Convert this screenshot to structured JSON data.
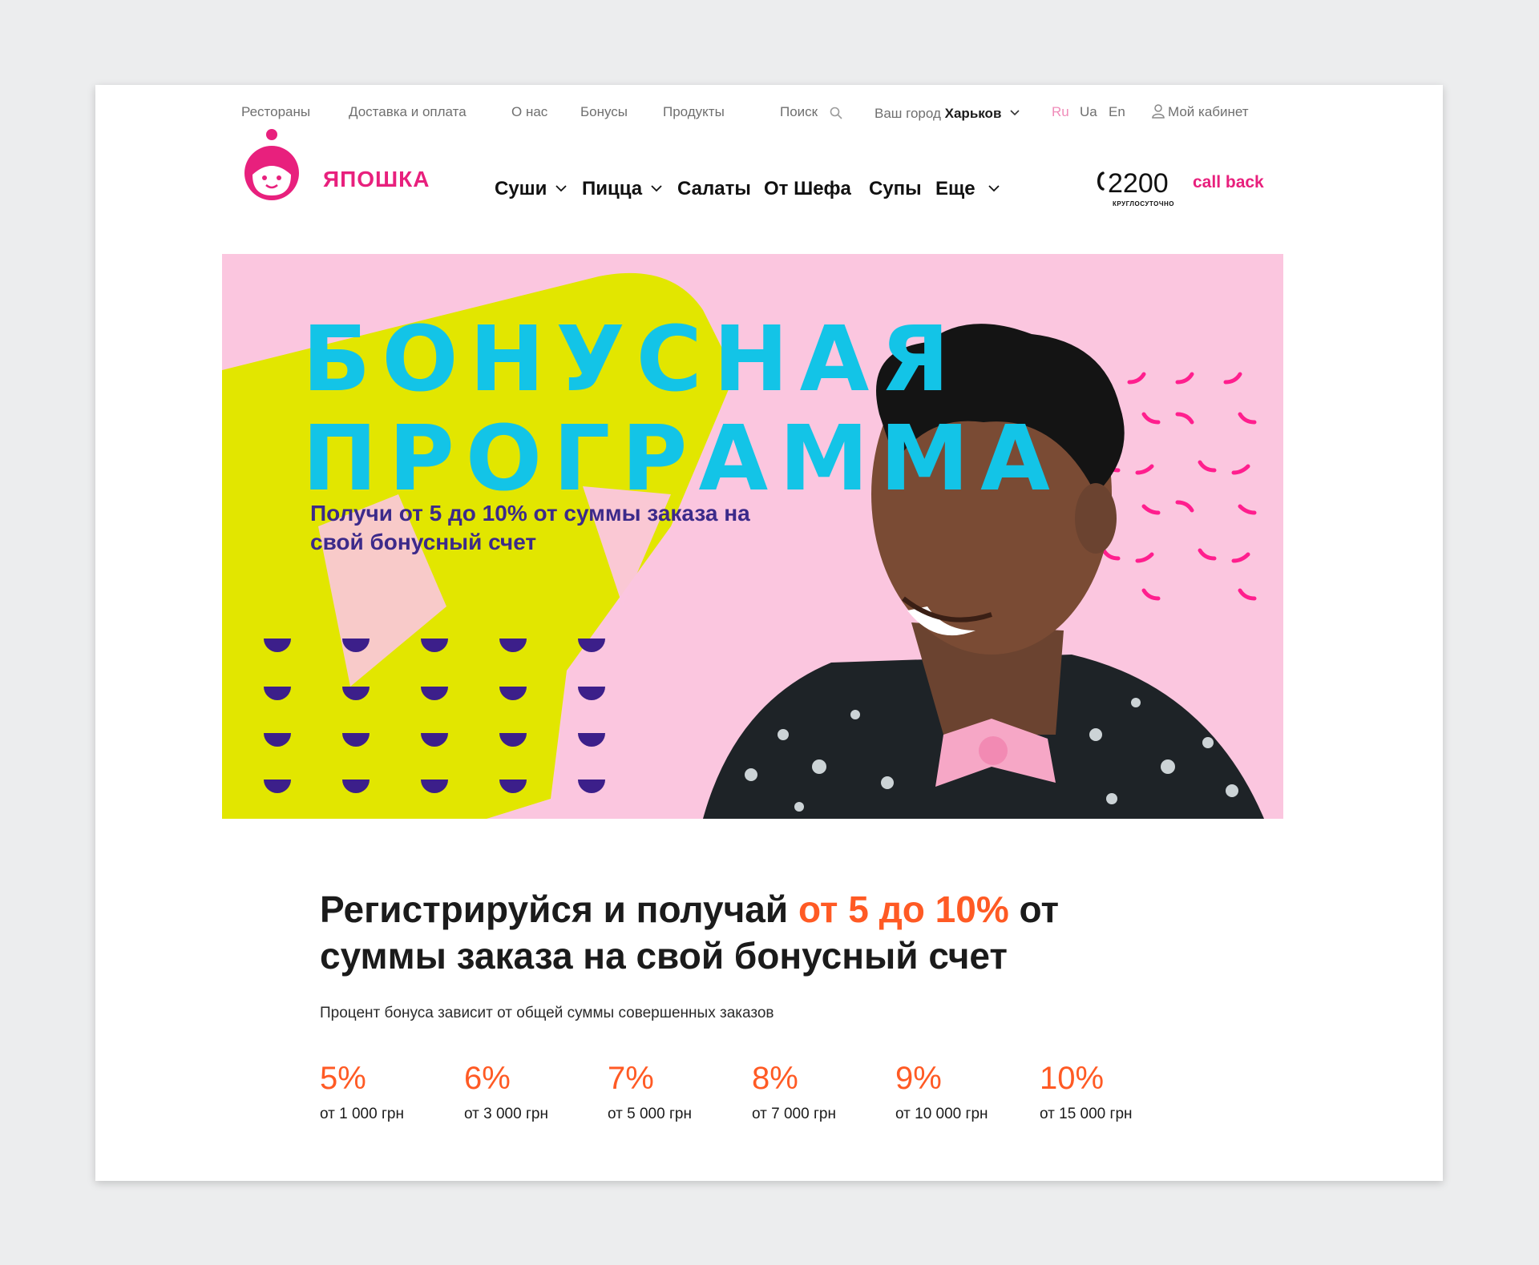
{
  "topbar": {
    "links": [
      "Рестораны",
      "Доставка и оплата",
      "О нас",
      "Бонусы",
      "Продукты"
    ],
    "search_label": "Поиск",
    "city_label": "Ваш город",
    "city_value": "Харьков",
    "languages": [
      "Ru",
      "Ua",
      "En"
    ],
    "active_language": "Ru",
    "cabinet_label": "Мой кабинет"
  },
  "brand": {
    "name": "ЯПОШКА"
  },
  "nav": {
    "items": [
      {
        "label": "Суши",
        "has_dropdown": true
      },
      {
        "label": "Пицца",
        "has_dropdown": true
      },
      {
        "label": "Салаты",
        "has_dropdown": false
      },
      {
        "label": "От Шефа",
        "has_dropdown": false
      },
      {
        "label": "Супы",
        "has_dropdown": false
      },
      {
        "label": "Еще",
        "has_dropdown": true
      }
    ]
  },
  "contact": {
    "phone": "2200",
    "phone_note": "круглосуточно",
    "callback_label": "call back"
  },
  "banner": {
    "title_line1": "БОНУСНАЯ",
    "title_line2": "ПРОГРАММА",
    "subtitle": "Получи от 5 до 10% от суммы заказа на свой бонусный счет"
  },
  "content": {
    "headline_before": "Регистрируйся и получай ",
    "headline_highlight": "от 5 до 10%",
    "headline_after": " от суммы заказа на свой бонусный счет",
    "note": "Процент бонуса зависит от общей суммы совершенных заказов",
    "tiers": [
      {
        "percent": "5%",
        "threshold": "от 1 000 грн"
      },
      {
        "percent": "6%",
        "threshold": "от 3 000 грн"
      },
      {
        "percent": "7%",
        "threshold": "от 5 000 грн"
      },
      {
        "percent": "8%",
        "threshold": "от 7 000 грн"
      },
      {
        "percent": "9%",
        "threshold": "от 10 000 грн"
      },
      {
        "percent": "10%",
        "threshold": "от 15 000 грн"
      }
    ]
  },
  "colors": {
    "accent_pink": "#e8207d",
    "accent_orange": "#ff5a24",
    "banner_bg": "#fbc6df",
    "banner_lime": "#e2e600",
    "banner_title": "#13c4e7",
    "banner_subtitle": "#3c2a8a"
  }
}
